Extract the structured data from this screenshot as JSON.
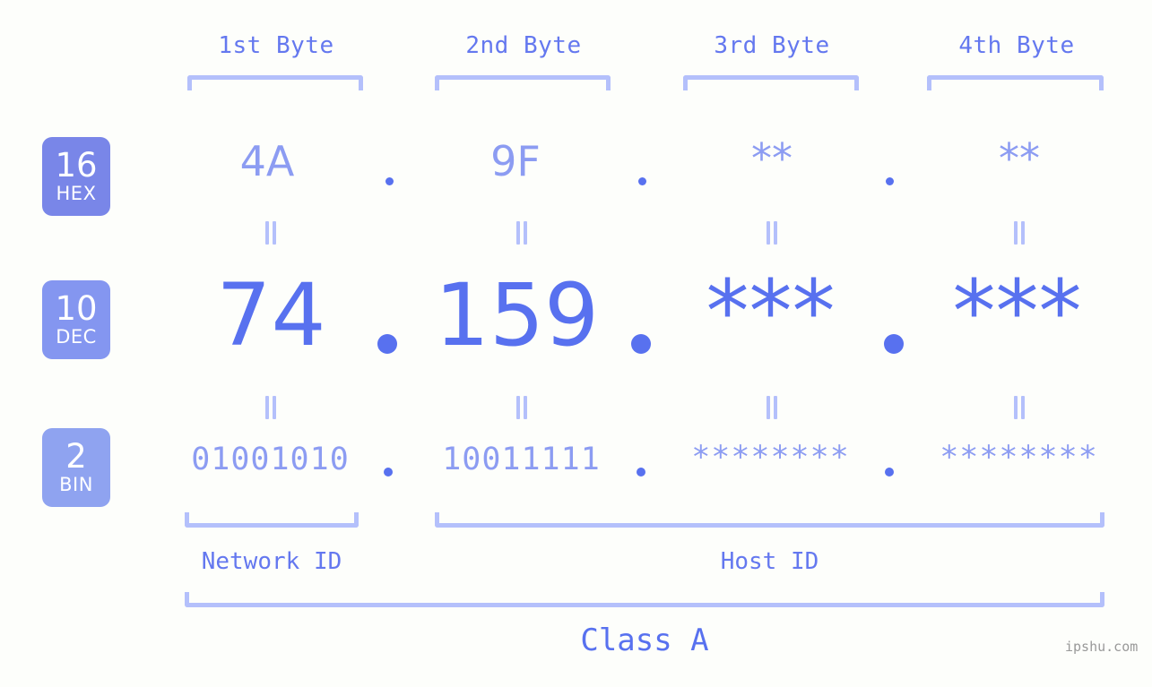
{
  "page": {
    "background": "#fdfefb",
    "watermark": "ipshu.com"
  },
  "colors": {
    "accent_strong": "#5871ef",
    "accent_mid": "#6478ef",
    "accent_light": "#8c9cf2",
    "bracket": "#b4c0fb",
    "badge_hex": "#7986e8",
    "badge_dec": "#8496f0",
    "badge_bin": "#8fa3f0",
    "watermark": "#999999"
  },
  "headers": [
    {
      "label": "1st Byte"
    },
    {
      "label": "2nd Byte"
    },
    {
      "label": "3rd Byte"
    },
    {
      "label": "4th Byte"
    }
  ],
  "bases": [
    {
      "number": "16",
      "label": "HEX",
      "color": "#7986e8"
    },
    {
      "number": "10",
      "label": "DEC",
      "color": "#8496f0"
    },
    {
      "number": "2",
      "label": "BIN",
      "color": "#8fa3f0"
    }
  ],
  "rows": {
    "hex": {
      "base_number": "16",
      "base_label": "HEX",
      "values": [
        "4A",
        "9F",
        "**",
        "**"
      ],
      "separator": "."
    },
    "dec": {
      "base_number": "10",
      "base_label": "DEC",
      "values": [
        "74",
        "159",
        "***",
        "***"
      ],
      "separator": "."
    },
    "bin": {
      "base_number": "2",
      "base_label": "BIN",
      "values": [
        "01001010",
        "10011111",
        "********",
        "********"
      ],
      "separator": "."
    }
  },
  "segments": {
    "network_id": "Network ID",
    "host_id": "Host ID",
    "class": "Class A"
  }
}
